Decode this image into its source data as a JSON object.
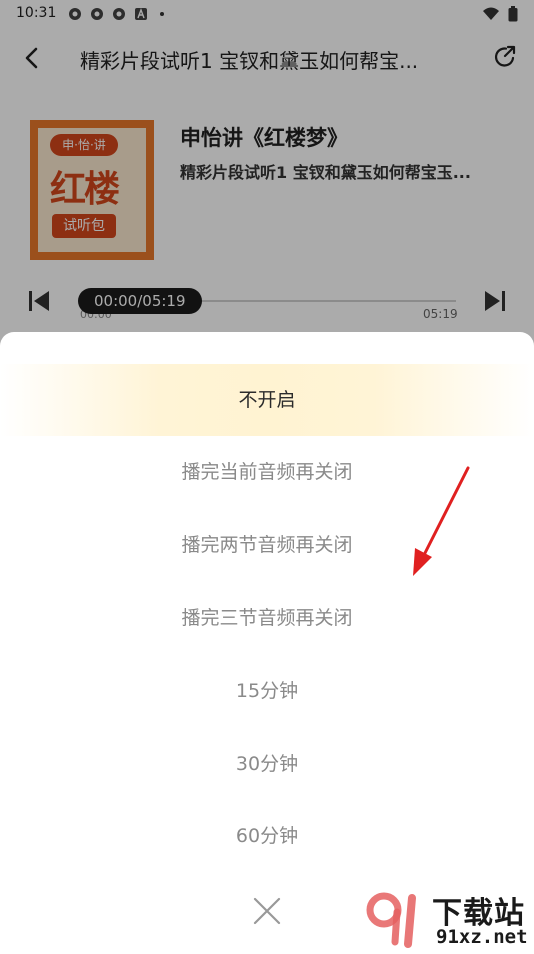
{
  "status": {
    "time": "10:31"
  },
  "header": {
    "title": "精彩片段试听1 宝钗和黛玉如何帮宝..."
  },
  "album": {
    "title": "申怡讲《红楼梦》",
    "subtitle": "精彩片段试听1 宝钗和黛玉如何帮宝玉...",
    "cover_tag": "申·怡·讲",
    "cover_big": "红楼",
    "cover_small": "试听包"
  },
  "player": {
    "time_display": "00:00/05:19",
    "start": "00:00",
    "end": "05:19",
    "progress": 0
  },
  "timer_sheet": {
    "options": [
      "不开启",
      "播完当前音频再关闭",
      "播完两节音频再关闭",
      "播完三节音频再关闭",
      "15分钟",
      "30分钟",
      "60分钟"
    ],
    "selected_index": 0
  },
  "watermark": {
    "brand": "下载站",
    "domain": "91xz.net"
  },
  "colors": {
    "accent": "#d2461c",
    "selected_bg": "#fff3d2",
    "arrow": "#e02020"
  }
}
